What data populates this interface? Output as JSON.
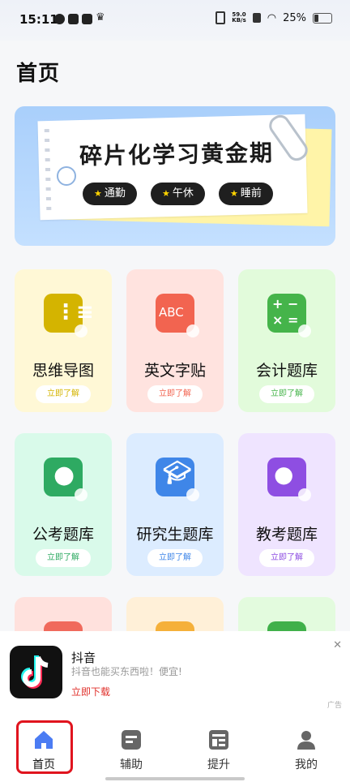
{
  "status_bar": {
    "time": "15:11",
    "net_speed_value": "59.0",
    "net_speed_unit": "KB/s",
    "battery": "25%"
  },
  "page": {
    "title": "首页"
  },
  "banner": {
    "title": "碎片化学习黄金期",
    "tags": [
      "通勤",
      "午休",
      "睡前"
    ]
  },
  "cards": [
    {
      "name": "思维导图",
      "button": "立即了解",
      "icon": "mind-map-icon",
      "bg": "#fff8d6",
      "accent": "#d4b400"
    },
    {
      "name": "英文字贴",
      "button": "立即了解",
      "icon": "abc-copybook-icon",
      "icon_text": "ABC",
      "bg": "#ffe3df",
      "accent": "#f26450"
    },
    {
      "name": "会计题库",
      "button": "立即了解",
      "icon": "calculator-icon",
      "bg": "#e2fbdb",
      "accent": "#45b44a"
    },
    {
      "name": "公考题库",
      "button": "立即了解",
      "icon": "civil-servant-icon",
      "bg": "#d9faea",
      "accent": "#2eaa62"
    },
    {
      "name": "研究生题库",
      "button": "立即了解",
      "icon": "graduate-cap-icon",
      "bg": "#dcecff",
      "accent": "#3f86e8"
    },
    {
      "name": "教考题库",
      "button": "立即了解",
      "icon": "teacher-icon",
      "bg": "#efe4ff",
      "accent": "#8e4ee2"
    },
    {
      "name": "",
      "button": "",
      "icon": "person-icon",
      "bg": "#ffe1dd",
      "accent": "#f06a5c"
    },
    {
      "name": "",
      "button": "",
      "icon": "folder-icon",
      "bg": "#fff0d8",
      "accent": "#f5b03a"
    },
    {
      "name": "",
      "button": "",
      "icon": "book-icon",
      "bg": "#e3fbde",
      "accent": "#40b04a"
    }
  ],
  "ad": {
    "app_name": "抖音",
    "description": "抖音也能买东西啦！便宜!",
    "download": "立即下载",
    "ad_tag": "广告"
  },
  "tabbar": [
    {
      "label": "首页",
      "icon": "home-icon",
      "active": true
    },
    {
      "label": "辅助",
      "icon": "assist-icon",
      "active": false
    },
    {
      "label": "提升",
      "icon": "improve-icon",
      "active": false
    },
    {
      "label": "我的",
      "icon": "profile-icon",
      "active": false
    }
  ],
  "colors": {
    "active_tab": "#4b7cf3",
    "inactive_tab": "#666666",
    "highlight_box": "#e0141e",
    "ad_download": "#e0302b"
  }
}
